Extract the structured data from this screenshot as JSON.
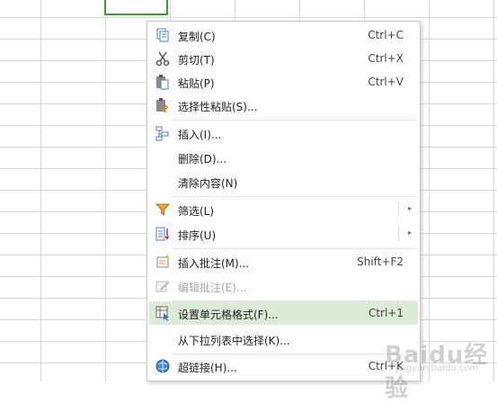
{
  "context_menu": {
    "items": [
      {
        "label": "复制(C)",
        "shortcut": "Ctrl+C",
        "icon": "copy-icon"
      },
      {
        "label": "剪切(T)",
        "shortcut": "Ctrl+X",
        "icon": "scissors-icon"
      },
      {
        "label": "粘贴(P)",
        "shortcut": "Ctrl+V",
        "icon": "paste-icon"
      },
      {
        "label": "选择性粘贴(S)...",
        "icon": "paste-special-icon"
      },
      {
        "label": "插入(I)...",
        "icon": "insert-icon"
      },
      {
        "label": "删除(D)..."
      },
      {
        "label": "清除内容(N)"
      },
      {
        "label": "筛选(L)",
        "icon": "filter-icon",
        "submenu": true
      },
      {
        "label": "排序(U)",
        "icon": "sort-icon",
        "submenu": true
      },
      {
        "label": "插入批注(M)...",
        "shortcut": "Shift+F2",
        "icon": "insert-comment-icon"
      },
      {
        "label": "编辑批注(E)...",
        "icon": "edit-comment-icon",
        "disabled": true
      },
      {
        "label": "设置单元格格式(F)...",
        "shortcut": "Ctrl+1",
        "icon": "format-cells-icon",
        "highlighted": true
      },
      {
        "label": "从下拉列表中选择(K)..."
      },
      {
        "label": "超链接(H)...",
        "shortcut": "Ctrl+K",
        "icon": "hyperlink-icon"
      }
    ],
    "submenu_arrow": "▸"
  },
  "watermark": {
    "brand": "Baidu经验",
    "sub": "jingyan.baidu.com"
  },
  "colors": {
    "highlight": "#dcebd6",
    "selection_border": "#3d9b33",
    "grid_line": "#d9d9d9"
  }
}
